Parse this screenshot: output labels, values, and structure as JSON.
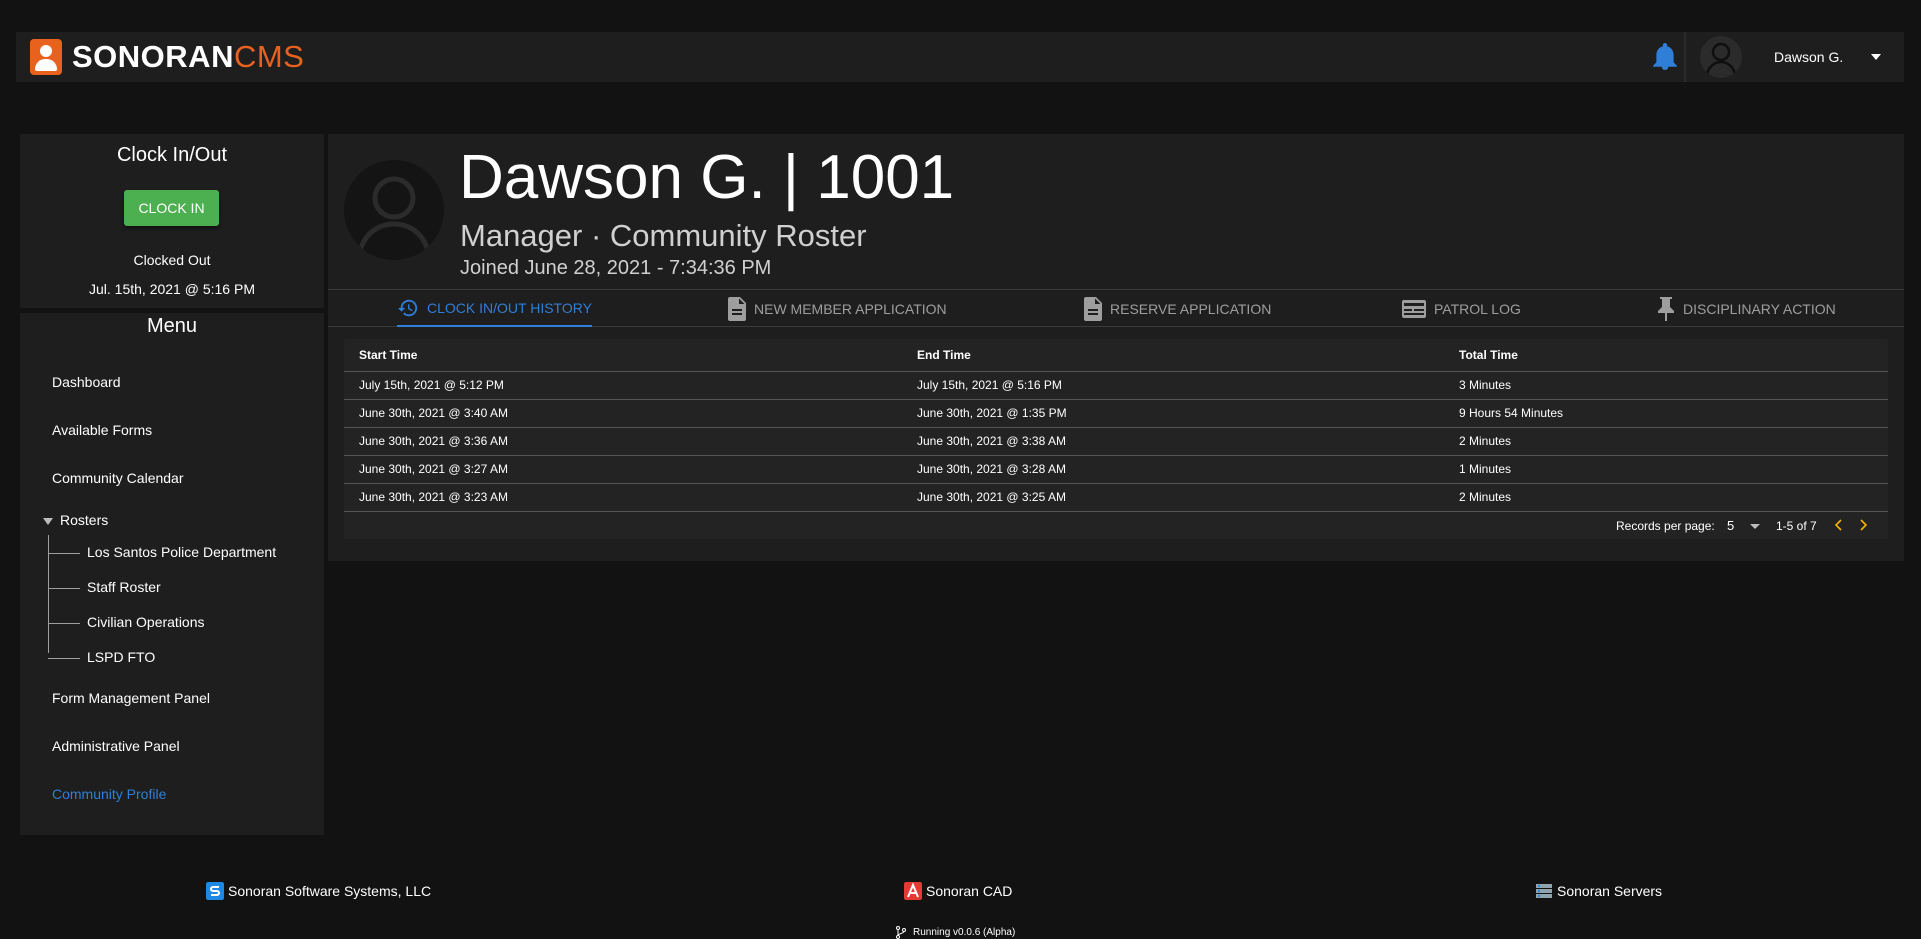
{
  "header": {
    "brand_primary": "SONORAN",
    "brand_secondary": "CMS",
    "user_name": "Dawson G."
  },
  "clock": {
    "title": "Clock In/Out",
    "button_label": "CLOCK IN",
    "status": "Clocked Out",
    "timestamp": "Jul. 15th, 2021 @ 5:16 PM"
  },
  "menu": {
    "title": "Menu",
    "items": [
      {
        "label": "Dashboard"
      },
      {
        "label": "Available Forms"
      },
      {
        "label": "Community Calendar"
      },
      {
        "label": "Rosters"
      },
      {
        "label": "Form Management Panel"
      },
      {
        "label": "Administrative Panel"
      },
      {
        "label": "Community Profile"
      }
    ],
    "rosters": [
      {
        "label": "Los Santos Police Department"
      },
      {
        "label": "Staff Roster"
      },
      {
        "label": "Civilian Operations"
      },
      {
        "label": "LSPD FTO"
      }
    ]
  },
  "profile": {
    "name_line": "Dawson G. | 1001",
    "role_line": "Manager · Community Roster",
    "joined_line": "Joined June 28, 2021 - 7:34:36 PM"
  },
  "tabs": [
    {
      "label": "CLOCK IN/OUT HISTORY",
      "icon": "history-icon"
    },
    {
      "label": "NEW MEMBER APPLICATION",
      "icon": "document-icon"
    },
    {
      "label": "RESERVE APPLICATION",
      "icon": "document-icon"
    },
    {
      "label": "PATROL LOG",
      "icon": "id-card-icon"
    },
    {
      "label": "DISCIPLINARY ACTION",
      "icon": "pin-icon"
    }
  ],
  "table": {
    "headers": [
      "Start Time",
      "End Time",
      "Total Time"
    ],
    "rows": [
      [
        "July 15th, 2021 @ 5:12 PM",
        "July 15th, 2021 @ 5:16 PM",
        "3 Minutes"
      ],
      [
        "June 30th, 2021 @ 3:40 AM",
        "June 30th, 2021 @ 1:35 PM",
        "9 Hours 54 Minutes"
      ],
      [
        "June 30th, 2021 @ 3:36 AM",
        "June 30th, 2021 @ 3:38 AM",
        "2 Minutes"
      ],
      [
        "June 30th, 2021 @ 3:27 AM",
        "June 30th, 2021 @ 3:28 AM",
        "1 Minutes"
      ],
      [
        "June 30th, 2021 @ 3:23 AM",
        "June 30th, 2021 @ 3:25 AM",
        "2 Minutes"
      ]
    ],
    "pagination": {
      "records_label": "Records per page:",
      "per_page": "5",
      "range": "1-5 of 7"
    }
  },
  "footer": {
    "links": [
      {
        "label": "Sonoran Software Systems, LLC"
      },
      {
        "label": "Sonoran CAD"
      },
      {
        "label": "Sonoran Servers"
      }
    ],
    "version": "Running v0.0.6 (Alpha)"
  },
  "colors": {
    "background": "#121212",
    "card": "#1e1e1e",
    "accent_blue": "#2f7fd8",
    "brand_orange": "#e8621e",
    "clock_in_green": "#4caf50",
    "pager_arrow": "#f5b400"
  }
}
